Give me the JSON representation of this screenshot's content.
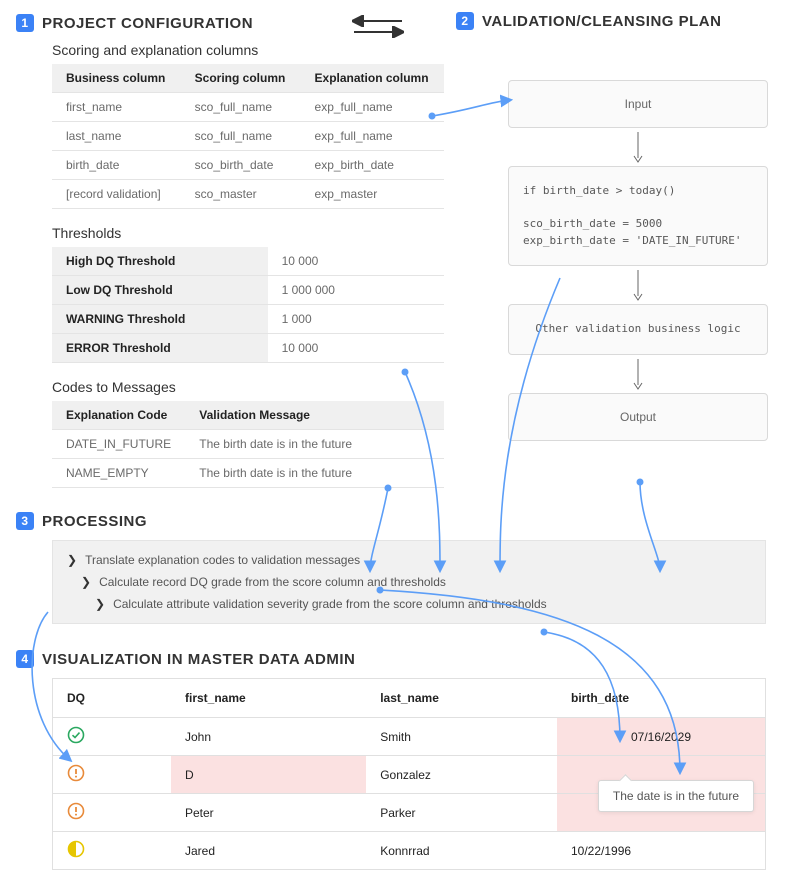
{
  "sections": {
    "s1": {
      "num": "1",
      "title": "PROJECT CONFIGURATION"
    },
    "s2": {
      "num": "2",
      "title": "VALIDATION/CLEANSING PLAN"
    },
    "s3": {
      "num": "3",
      "title": "PROCESSING"
    },
    "s4": {
      "num": "4",
      "title": "VISUALIZATION IN MASTER DATA ADMIN"
    }
  },
  "config": {
    "scoring": {
      "title": "Scoring and explanation columns",
      "headers": {
        "c1": "Business column",
        "c2": "Scoring column",
        "c3": "Explanation column"
      },
      "rows": [
        {
          "c1": "first_name",
          "c2": "sco_full_name",
          "c3": "exp_full_name"
        },
        {
          "c1": "last_name",
          "c2": "sco_full_name",
          "c3": "exp_full_name"
        },
        {
          "c1": "birth_date",
          "c2": "sco_birth_date",
          "c3": "exp_birth_date"
        },
        {
          "c1": "[record validation]",
          "c2": "sco_master",
          "c3": "exp_master"
        }
      ]
    },
    "thresholds": {
      "title": "Thresholds",
      "rows": [
        {
          "label": "High DQ Threshold",
          "value": "10 000"
        },
        {
          "label": "Low DQ Threshold",
          "value": "1 000 000"
        },
        {
          "label": "WARNING Threshold",
          "value": "1 000"
        },
        {
          "label": "ERROR Threshold",
          "value": "10 000"
        }
      ]
    },
    "codes": {
      "title": "Codes to Messages",
      "headers": {
        "c1": "Explanation Code",
        "c2": "Validation Message"
      },
      "rows": [
        {
          "c1": "DATE_IN_FUTURE",
          "c2": "The birth date is in the future"
        },
        {
          "c1": "NAME_EMPTY",
          "c2": "The birth date is in the future"
        }
      ]
    }
  },
  "flow": {
    "input": "Input",
    "code_line1": "if birth_date > today()",
    "code_line2": "sco_birth_date = 5000",
    "code_line3": "exp_birth_date = 'DATE_IN_FUTURE'",
    "logic": "Other validation business logic",
    "output": "Output"
  },
  "processing": {
    "items": [
      "Translate explanation codes to validation messages",
      "Calculate record DQ grade from the score column and thresholds",
      "Calculate attribute validation severity grade from the score column and thresholds"
    ]
  },
  "viz": {
    "headers": {
      "dq": "DQ",
      "first": "first_name",
      "last": "last_name",
      "birth": "birth_date"
    },
    "rows": [
      {
        "dq": "ok",
        "first": "John",
        "last": "Smith",
        "birth": "07/16/2029",
        "birth_err": true
      },
      {
        "dq": "err",
        "first": "D",
        "last": "Gonzalez",
        "birth": "",
        "first_err": true,
        "birth_err": true
      },
      {
        "dq": "err",
        "first": "Peter",
        "last": "Parker",
        "birth": "",
        "birth_err": true
      },
      {
        "dq": "warn",
        "first": "Jared",
        "last": "Konnrrad",
        "birth": "10/22/1996"
      }
    ],
    "tooltip": "The date is in the future"
  }
}
